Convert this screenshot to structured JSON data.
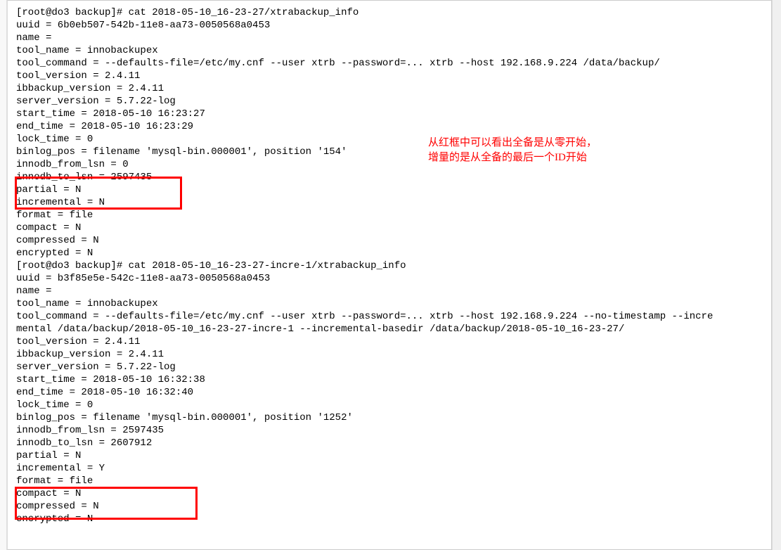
{
  "terminal": {
    "lines": [
      "[root@do3 backup]# cat 2018-05-10_16-23-27/xtrabackup_info",
      "uuid = 6b0eb507-542b-11e8-aa73-0050568a0453",
      "name =",
      "tool_name = innobackupex",
      "tool_command = --defaults-file=/etc/my.cnf --user xtrb --password=... xtrb --host 192.168.9.224 /data/backup/",
      "tool_version = 2.4.11",
      "ibbackup_version = 2.4.11",
      "server_version = 5.7.22-log",
      "start_time = 2018-05-10 16:23:27",
      "end_time = 2018-05-10 16:23:29",
      "lock_time = 0",
      "binlog_pos = filename 'mysql-bin.000001', position '154'",
      "innodb_from_lsn = 0",
      "innodb_to_lsn = 2597435",
      "partial = N",
      "incremental = N",
      "format = file",
      "compact = N",
      "compressed = N",
      "encrypted = N",
      "[root@do3 backup]# cat 2018-05-10_16-23-27-incre-1/xtrabackup_info",
      "uuid = b3f85e5e-542c-11e8-aa73-0050568a0453",
      "name =",
      "tool_name = innobackupex",
      "tool_command = --defaults-file=/etc/my.cnf --user xtrb --password=... xtrb --host 192.168.9.224 --no-timestamp --incre",
      "mental /data/backup/2018-05-10_16-23-27-incre-1 --incremental-basedir /data/backup/2018-05-10_16-23-27/",
      "tool_version = 2.4.11",
      "ibbackup_version = 2.4.11",
      "server_version = 5.7.22-log",
      "start_time = 2018-05-10 16:32:38",
      "end_time = 2018-05-10 16:32:40",
      "lock_time = 0",
      "binlog_pos = filename 'mysql-bin.000001', position '1252'",
      "innodb_from_lsn = 2597435",
      "innodb_to_lsn = 2607912",
      "partial = N",
      "incremental = Y",
      "format = file",
      "compact = N",
      "compressed = N",
      "encrypted = N"
    ]
  },
  "annotations": {
    "line1": "从红框中可以看出全备是从零开始，",
    "line2": "增量的是从全备的最后一个ID开始"
  }
}
